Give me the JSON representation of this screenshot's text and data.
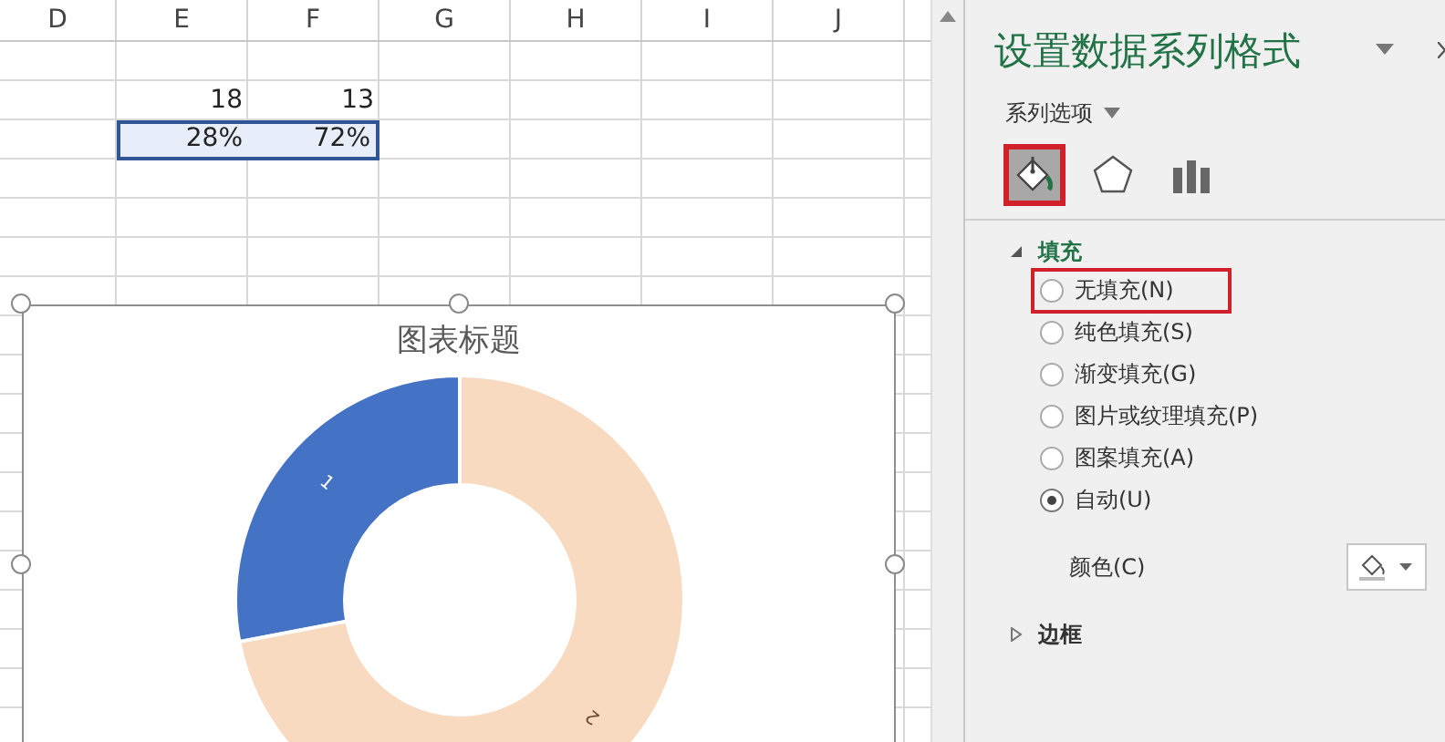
{
  "sheet": {
    "columns": [
      "D",
      "E",
      "F",
      "G",
      "H",
      "I",
      "J"
    ],
    "rows": [
      {
        "cells": [
          {},
          {},
          {},
          {},
          {},
          {},
          {}
        ]
      },
      {
        "cells": [
          {},
          {
            "value": "18",
            "selected": false
          },
          {
            "value": "13",
            "selected": false
          },
          {},
          {},
          {},
          {}
        ]
      },
      {
        "cells": [
          {},
          {
            "value": "28%",
            "selected": true
          },
          {
            "value": "72%",
            "selected": true
          },
          {},
          {},
          {},
          {}
        ]
      }
    ],
    "chart": {
      "chart_data": {
        "type": "donut",
        "title": "图表标题",
        "categories": [
          "1",
          "2"
        ],
        "series": [
          {
            "values": [
              28,
              72
            ]
          }
        ],
        "colors": [
          "#4472c4",
          "#f8dac1"
        ]
      }
    }
  },
  "panel": {
    "title": "设置数据系列格式",
    "subtitle": "系列选项",
    "tabs": [
      {
        "kind": "fill",
        "selected": true,
        "highlighted": true
      },
      {
        "kind": "effects",
        "selected": false,
        "highlighted": false
      },
      {
        "kind": "options",
        "selected": false,
        "highlighted": false
      }
    ],
    "sections": [
      {
        "label": "填充",
        "expanded": true,
        "options": [
          {
            "label": "无填充(N)",
            "selected": false,
            "highlighted": true
          },
          {
            "label": "纯色填充(S)",
            "selected": false,
            "highlighted": false
          },
          {
            "label": "渐变填充(G)",
            "selected": false,
            "highlighted": false
          },
          {
            "label": "图片或纹理填充(P)",
            "selected": false,
            "highlighted": false
          },
          {
            "label": "图案填充(A)",
            "selected": false,
            "highlighted": false
          },
          {
            "label": "自动(U)",
            "selected": true,
            "highlighted": false
          }
        ],
        "color_label": "颜色(C)"
      },
      {
        "label": "边框",
        "expanded": false
      }
    ]
  }
}
